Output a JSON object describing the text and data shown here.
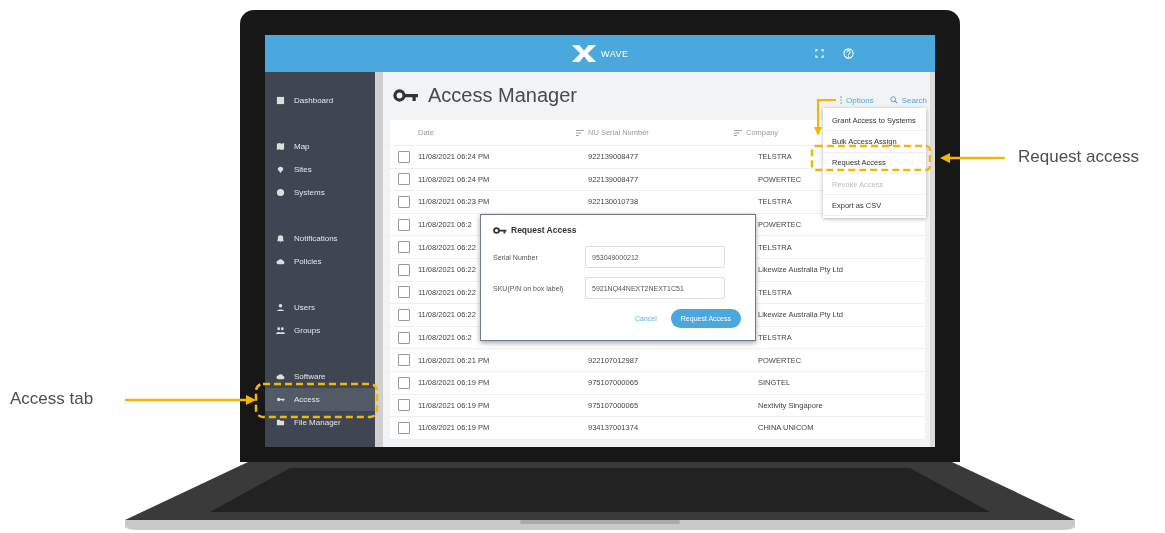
{
  "annotations": [
    {
      "label": "Access tab"
    },
    {
      "label": "Request access"
    }
  ],
  "header": {
    "logo_text": "WAVE"
  },
  "sidebar": {
    "sections": [
      {
        "items": [
          {
            "label": "Dashboard",
            "selected": false
          }
        ]
      },
      {
        "items": [
          {
            "label": "Map",
            "selected": false
          },
          {
            "label": "Sites",
            "selected": false
          },
          {
            "label": "Systems",
            "selected": false
          }
        ]
      },
      {
        "items": [
          {
            "label": "Notifications",
            "selected": false
          },
          {
            "label": "Policies",
            "selected": false
          }
        ]
      },
      {
        "items": [
          {
            "label": "Users",
            "selected": false
          },
          {
            "label": "Groups",
            "selected": false
          }
        ]
      },
      {
        "items": [
          {
            "label": "Software",
            "selected": false
          },
          {
            "label": "Access",
            "selected": true
          },
          {
            "label": "File Manager",
            "selected": false
          }
        ]
      }
    ]
  },
  "page": {
    "title": "Access Manager",
    "options_label": "Options",
    "search_label": "Search"
  },
  "options_menu": [
    {
      "label": "Grant Access to Systems",
      "disabled": false
    },
    {
      "label": "Bulk Access Assign",
      "disabled": false
    },
    {
      "label": "Request Access",
      "disabled": false
    },
    {
      "label": "Revoke Access",
      "disabled": true
    },
    {
      "label": "Export as CSV",
      "disabled": false
    }
  ],
  "table": {
    "columns": [
      {
        "label": "Date",
        "sortable": false
      },
      {
        "label": "NU Serial Number",
        "sortable": true
      },
      {
        "label": "Company",
        "sortable": true
      }
    ],
    "rows": [
      {
        "checked": false,
        "date": "11/08/2021 06:24 PM",
        "serial": "922139008477",
        "company": "TELSTRA"
      },
      {
        "checked": false,
        "date": "11/08/2021 06:24 PM",
        "serial": "922139008477",
        "company": "POWERTEC"
      },
      {
        "checked": false,
        "date": "11/08/2021 06:23 PM",
        "serial": "922130010738",
        "company": "TELSTRA"
      },
      {
        "checked": false,
        "date": "11/08/2021 06:2",
        "company": "POWERTEC"
      },
      {
        "checked": false,
        "date": "11/08/2021 06:22",
        "company": "TELSTRA"
      },
      {
        "checked": false,
        "date": "11/08/2021 06:22",
        "company": "Likewize Australia Pty Ltd"
      },
      {
        "checked": false,
        "date": "11/08/2021 06:22",
        "company": "TELSTRA"
      },
      {
        "checked": false,
        "date": "11/08/2021 06:22",
        "company": "Likewize Australia Pty Ltd"
      },
      {
        "checked": false,
        "date": "11/08/2021 06:2",
        "company": "TELSTRA"
      },
      {
        "checked": false,
        "date": "11/08/2021 06:21 PM",
        "serial": "922107012987",
        "company": "POWERTEC"
      },
      {
        "checked": false,
        "date": "11/08/2021 06:19 PM",
        "serial": "975107000065",
        "company": "SINGTEL"
      },
      {
        "checked": false,
        "date": "11/08/2021 06:19 PM",
        "serial": "975107000065",
        "company": "Nextivity Singapore"
      },
      {
        "checked": false,
        "date": "11/08/2021 06:19 PM",
        "serial": "934137001374",
        "company": "CHINA UNICOM"
      }
    ]
  },
  "dialog": {
    "title": "Request Access",
    "fields": [
      {
        "label": "Serial Number",
        "value": "953049000212"
      },
      {
        "label": "SKU(P/N on box label)",
        "value": "5921NQ44NEXT2NEXT1C51"
      }
    ],
    "cancel_label": "Cancel",
    "submit_label": "Request Access"
  }
}
